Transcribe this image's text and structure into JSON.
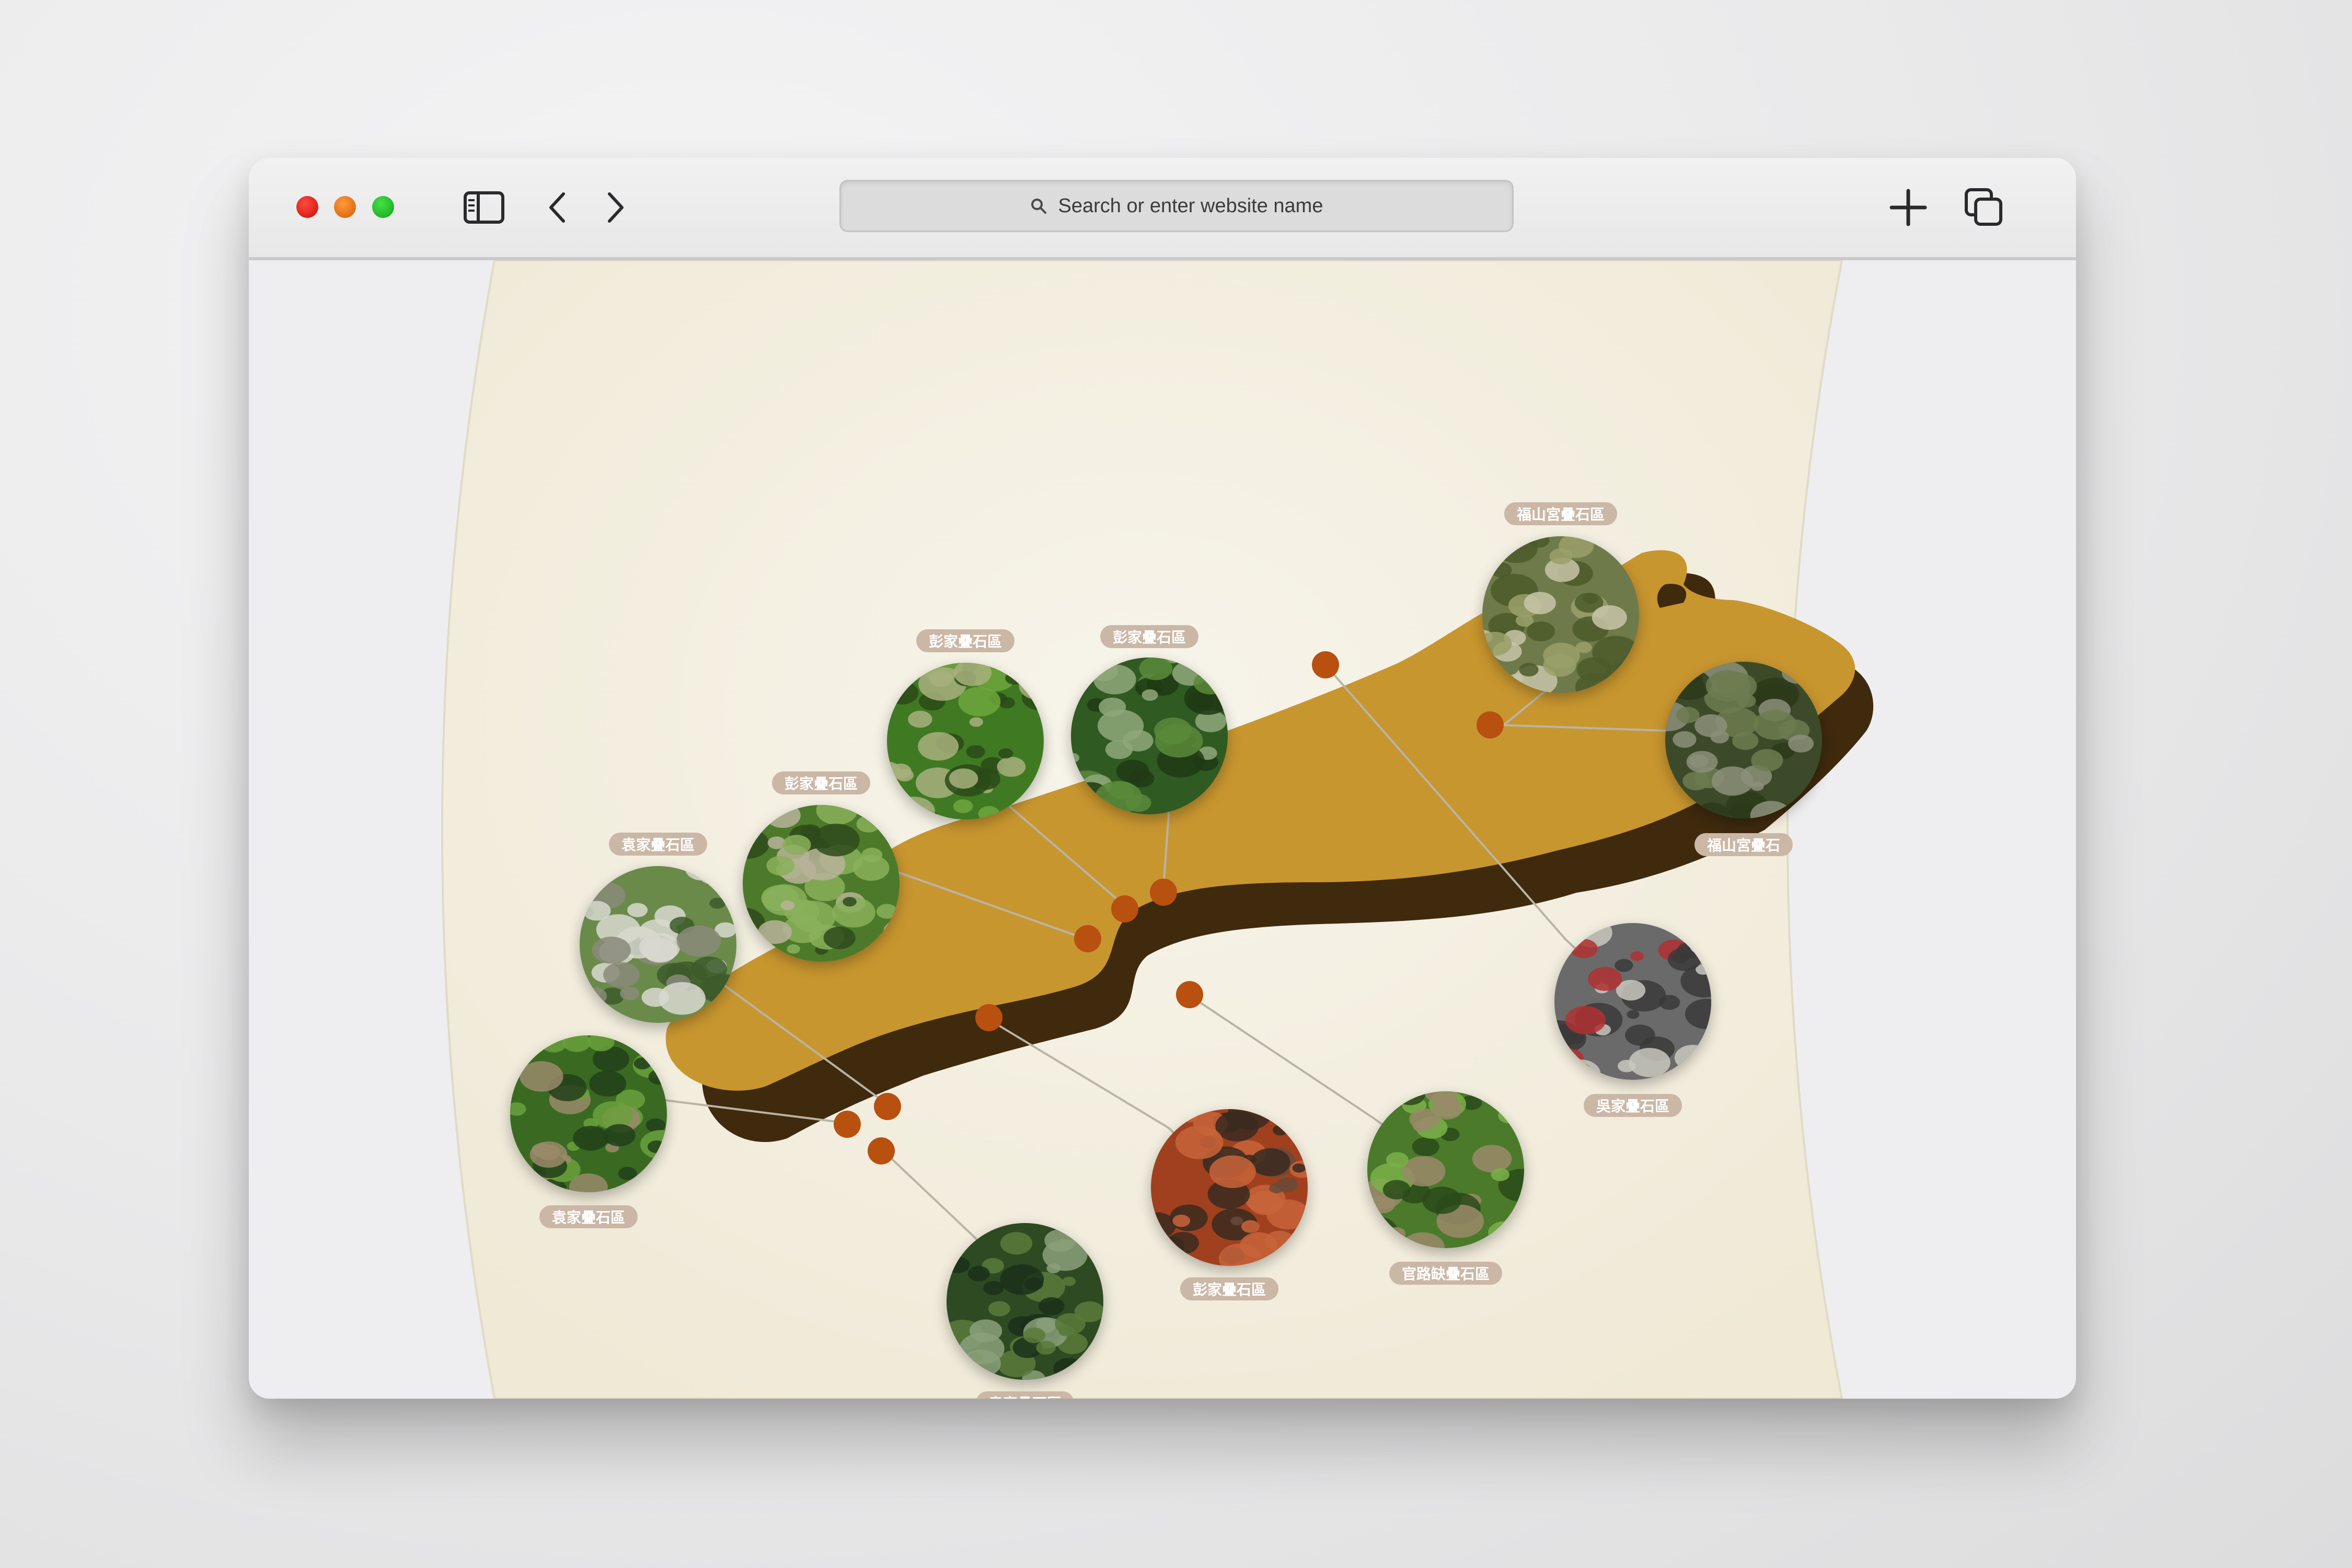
{
  "browser": {
    "search_placeholder": "Search or enter website name",
    "icons": [
      "sidebar-icon",
      "back-icon",
      "forward-icon",
      "search-icon",
      "new-tab-icon",
      "tabs-overview-icon"
    ]
  },
  "map": {
    "colors": {
      "land": "#c8962f",
      "land_shadow": "#3f2a0e",
      "marker": "#b8500f",
      "panel": "#f4f0e3"
    },
    "sites": [
      {
        "label": "福山宮疊石區"
      },
      {
        "label": "福山宮疊石"
      },
      {
        "label": "彭家疊石區"
      },
      {
        "label": "彭家疊石區"
      },
      {
        "label": "彭家疊石區"
      },
      {
        "label": "袁家疊石區"
      },
      {
        "label": "袁家疊石區"
      },
      {
        "label": "袁家疊石區"
      },
      {
        "label": "彭家疊石區"
      },
      {
        "label": "官路缺疊石區"
      },
      {
        "label": "吳家疊石區"
      }
    ]
  }
}
